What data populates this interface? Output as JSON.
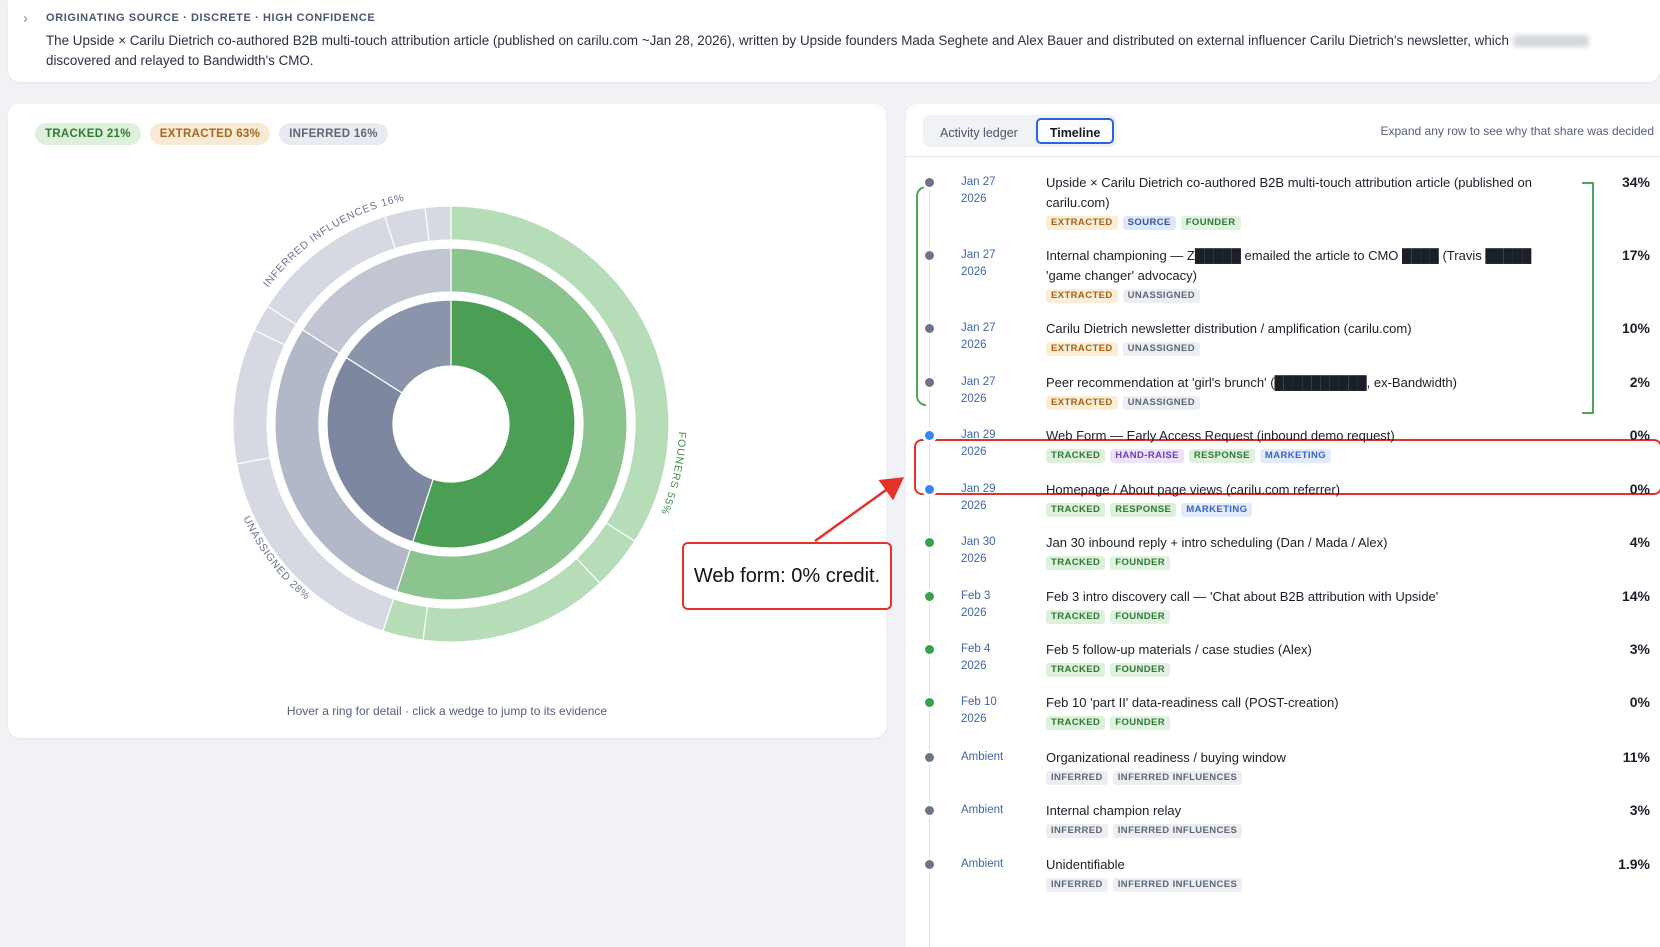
{
  "source": {
    "heading": "ORIGINATING SOURCE · DISCRETE · HIGH CONFIDENCE",
    "text_before": "The Upside × Carilu Dietrich co-authored B2B multi-touch attribution article (published on carilu.com ~Jan 28, 2026), written by Upside founders Mada Seghete and Alex Bauer and distributed on external influencer Carilu Dietrich's newsletter, which",
    "text_after": "discovered and relayed to Bandwidth's CMO."
  },
  "legend": {
    "tracked": "TRACKED 21%",
    "extracted": "EXTRACTED 63%",
    "inferred": "INFERRED 16%"
  },
  "chart_data": {
    "type": "sunburst",
    "rings": [
      {
        "name": "inner",
        "segments": [
          {
            "label": "Founders",
            "value": 55,
            "color": "#4a9f55"
          },
          {
            "label": "Unassigned",
            "value": 29,
            "color": "#7e87a0"
          },
          {
            "label": "Inferred influences",
            "value": 16,
            "color": "#8c94ab"
          }
        ]
      },
      {
        "name": "middle",
        "segments": [
          {
            "label": "Founders",
            "value": 55,
            "color": "#8bc48f"
          },
          {
            "label": "Unassigned",
            "value": 29,
            "color": "#b3b8c8"
          },
          {
            "label": "Inferred influences",
            "value": 16,
            "color": "#c2c6d3"
          }
        ]
      },
      {
        "name": "outer",
        "segments": [
          {
            "label": "Upside × Carilu article",
            "value": 34,
            "color": "#b6dcb8"
          },
          {
            "label": "Homepage views",
            "value": 0,
            "color": "#b6dcb8"
          },
          {
            "label": "Jan 30 inbound reply",
            "value": 4,
            "color": "#b6dcb8"
          },
          {
            "label": "Feb 3 intro call",
            "value": 14,
            "color": "#b6dcb8"
          },
          {
            "label": "Feb 5 follow-up",
            "value": 3,
            "color": "#b6dcb8"
          },
          {
            "label": "Internal championing",
            "value": 17,
            "color": "#d6d9e2"
          },
          {
            "label": "Newsletter distribution",
            "value": 10,
            "color": "#d6d9e2"
          },
          {
            "label": "Peer recommendation",
            "value": 2,
            "color": "#d6d9e2"
          },
          {
            "label": "Organizational readiness",
            "value": 11,
            "color": "#d6d9e2"
          },
          {
            "label": "Internal champion relay",
            "value": 3,
            "color": "#d6d9e2"
          },
          {
            "label": "Unidentifiable",
            "value": 1.9,
            "color": "#d6d9e2"
          }
        ]
      }
    ],
    "arc_labels": {
      "founders": "FOUNERS 55%",
      "unassigned": "UNASSIGNED 28%",
      "inferred": "INFERRED INFLUENCES 16%"
    }
  },
  "chart_hint": "Hover a ring for detail · click a wedge to jump to its evidence",
  "callout": "Web form: 0% credit.",
  "tabs": {
    "ledger": "Activity ledger",
    "timeline": "Timeline",
    "hint": "Expand any row to see why that share was decided"
  },
  "colors": {
    "dot_green": "#3aa24b",
    "dot_gray": "#6c7488",
    "dot_blue": "#3b82f6",
    "highlight": "#e2322b"
  },
  "timeline": [
    {
      "date1": "Jan 27",
      "date2": "2026",
      "title": "Upside × Carilu Dietrich co-authored B2B multi-touch attribution article (published on carilu.com)",
      "share": "34%",
      "dot": "gray",
      "tags": [
        {
          "label": "EXTRACTED",
          "kind": "extracted"
        },
        {
          "label": "SOURCE",
          "kind": "source"
        },
        {
          "label": "FOUNDER",
          "kind": "founder"
        }
      ]
    },
    {
      "date1": "Jan 27",
      "date2": "2026",
      "title": "Internal championing — Z█████ emailed the article to CMO ████ (Travis █████ 'game changer' advocacy)",
      "share": "17%",
      "dot": "gray",
      "tags": [
        {
          "label": "EXTRACTED",
          "kind": "extracted"
        },
        {
          "label": "UNASSIGNED",
          "kind": "unassigned"
        }
      ]
    },
    {
      "date1": "Jan 27",
      "date2": "2026",
      "title": "Carilu Dietrich newsletter distribution / amplification (carilu.com)",
      "share": "10%",
      "dot": "gray",
      "tags": [
        {
          "label": "EXTRACTED",
          "kind": "extracted"
        },
        {
          "label": "UNASSIGNED",
          "kind": "unassigned"
        }
      ]
    },
    {
      "date1": "Jan 27",
      "date2": "2026",
      "title": "Peer recommendation at 'girl's brunch' (██████████, ex-Bandwidth)",
      "share": "2%",
      "dot": "gray",
      "tags": [
        {
          "label": "EXTRACTED",
          "kind": "extracted"
        },
        {
          "label": "UNASSIGNED",
          "kind": "unassigned"
        }
      ]
    },
    {
      "date1": "Jan 29",
      "date2": "2026",
      "title": "Web Form — Early Access Request (inbound demo request)",
      "share": "0%",
      "dot": "blue",
      "tags": [
        {
          "label": "TRACKED",
          "kind": "tracked"
        },
        {
          "label": "HAND-RAISE",
          "kind": "hand-raise"
        },
        {
          "label": "RESPONSE",
          "kind": "response"
        },
        {
          "label": "MARKETING",
          "kind": "marketing"
        }
      ]
    },
    {
      "date1": "Jan 29",
      "date2": "2026",
      "title": "Homepage / About page views (carilu.com referrer)",
      "share": "0%",
      "dot": "blue",
      "tags": [
        {
          "label": "TRACKED",
          "kind": "tracked"
        },
        {
          "label": "RESPONSE",
          "kind": "response"
        },
        {
          "label": "MARKETING",
          "kind": "marketing"
        }
      ]
    },
    {
      "date1": "Jan 30",
      "date2": "2026",
      "title": "Jan 30 inbound reply + intro scheduling (Dan / Mada / Alex)",
      "share": "4%",
      "dot": "green",
      "tags": [
        {
          "label": "TRACKED",
          "kind": "tracked"
        },
        {
          "label": "FOUNDER",
          "kind": "founder"
        }
      ]
    },
    {
      "date1": "Feb 3",
      "date2": "2026",
      "title": "Feb 3 intro discovery call — 'Chat about B2B attribution with Upside'",
      "share": "14%",
      "dot": "green",
      "tags": [
        {
          "label": "TRACKED",
          "kind": "tracked"
        },
        {
          "label": "FOUNDER",
          "kind": "founder"
        }
      ]
    },
    {
      "date1": "Feb 4",
      "date2": "2026",
      "title": "Feb 5 follow-up materials / case studies (Alex)",
      "share": "3%",
      "dot": "green",
      "tags": [
        {
          "label": "TRACKED",
          "kind": "tracked"
        },
        {
          "label": "FOUNDER",
          "kind": "founder"
        }
      ]
    },
    {
      "date1": "Feb 10",
      "date2": "2026",
      "title": "Feb 10 'part II' data-readiness call (POST-creation)",
      "share": "0%",
      "dot": "green",
      "tags": [
        {
          "label": "TRACKED",
          "kind": "tracked"
        },
        {
          "label": "FOUNDER",
          "kind": "founder"
        }
      ]
    },
    {
      "date1": "Ambient",
      "date2": "",
      "title": "Organizational readiness / buying window",
      "share": "11%",
      "dot": "gray",
      "tags": [
        {
          "label": "INFERRED",
          "kind": "inferred"
        },
        {
          "label": "INFERRED INFLUENCES",
          "kind": "inferred-influences"
        }
      ]
    },
    {
      "date1": "Ambient",
      "date2": "",
      "title": "Internal champion relay",
      "share": "3%",
      "dot": "gray",
      "tags": [
        {
          "label": "INFERRED",
          "kind": "inferred"
        },
        {
          "label": "INFERRED INFLUENCES",
          "kind": "inferred-influences"
        }
      ]
    },
    {
      "date1": "Ambient",
      "date2": "",
      "title": "Unidentifiable",
      "share": "1.9%",
      "dot": "gray",
      "tags": [
        {
          "label": "INFERRED",
          "kind": "inferred"
        },
        {
          "label": "INFERRED INFLUENCES",
          "kind": "inferred-influences"
        }
      ]
    }
  ]
}
